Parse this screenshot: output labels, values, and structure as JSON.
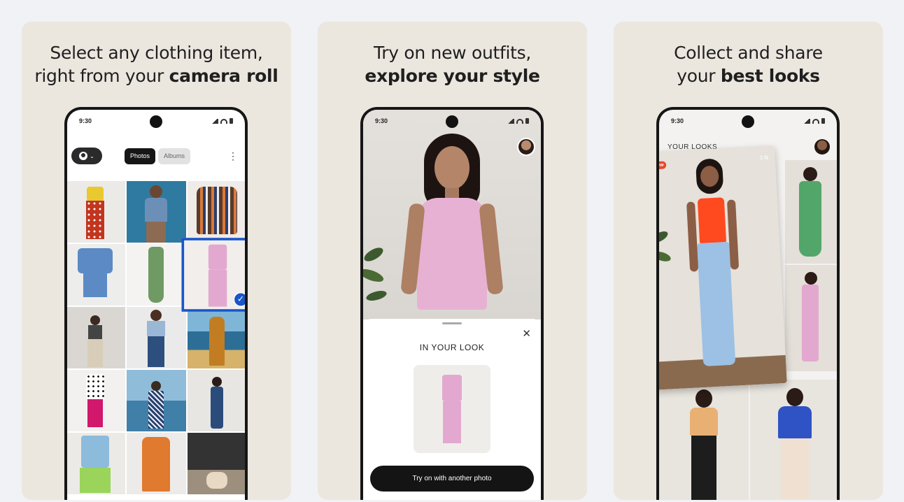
{
  "panels": [
    {
      "headline_regular": "Select any clothing item,",
      "headline_prefix": "right from your ",
      "headline_bold": "camera roll",
      "status_time": "9:30",
      "tabs": [
        "Photos",
        "Albums"
      ],
      "selected_item": "pink vest and trousers"
    },
    {
      "headline_regular": "Try on new outfits,",
      "headline_bold": "explore your style",
      "status_time": "9:30",
      "sheet_title": "IN YOUR LOOK",
      "cta_label": "Try on with another photo"
    },
    {
      "headline_regular": "Collect and share",
      "headline_prefix": "your ",
      "headline_bold": "best looks",
      "status_time": "9:30",
      "section_label": "YOUR LOOKS",
      "badge": "New",
      "count": "3"
    }
  ],
  "colors": {
    "panel_bg": "#ebe7df",
    "page_bg": "#f0f2f5",
    "selection": "#1a55c9",
    "badge": "#e8472e",
    "cta_bg": "#141414"
  }
}
